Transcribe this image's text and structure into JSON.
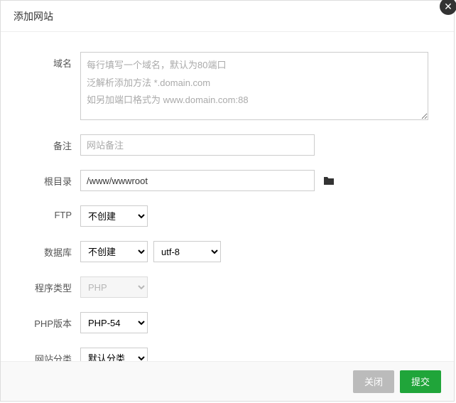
{
  "dialog": {
    "title": "添加网站"
  },
  "labels": {
    "domain": "域名",
    "note": "备注",
    "root": "根目录",
    "ftp": "FTP",
    "database": "数据库",
    "program": "程序类型",
    "php": "PHP版本",
    "category": "网站分类"
  },
  "placeholders": {
    "domain": "每行填写一个域名，默认为80端口\n泛解析添加方法 *.domain.com\n如另加端口格式为 www.domain.com:88",
    "note": "网站备注"
  },
  "values": {
    "root": "/www/wwwroot"
  },
  "options": {
    "ftp": "不创建",
    "database": "不创建",
    "charset": "utf-8",
    "program": "PHP",
    "php": "PHP-54",
    "category": "默认分类"
  },
  "buttons": {
    "cancel": "关闭",
    "submit": "提交"
  }
}
